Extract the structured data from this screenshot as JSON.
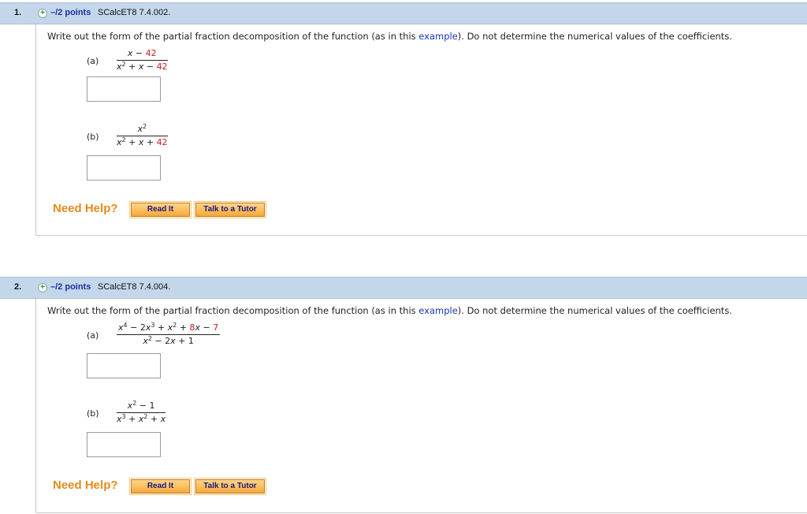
{
  "q1": {
    "number": "1.",
    "points": "–/2 points",
    "source": "SCalcET8 7.4.002.",
    "instruction_pre": "Write out the form of the partial fraction decomposition of the function (as in this ",
    "instruction_link": "example",
    "instruction_post": "). Do not determine the numerical values of the coefficients.",
    "a_label": "(a)",
    "b_label": "(b)",
    "help_label": "Need Help?",
    "read_label": "Read It",
    "tutor_label": "Talk to a Tutor"
  },
  "q2": {
    "number": "2.",
    "points": "–/2 points",
    "source": "SCalcET8 7.4.004.",
    "instruction_pre": "Write out the form of the partial fraction decomposition of the function (as in this ",
    "instruction_link": "example",
    "instruction_post": "). Do not determine the numerical values of the coefficients.",
    "a_label": "(a)",
    "b_label": "(b)",
    "help_label": "Need Help?",
    "read_label": "Read It",
    "tutor_label": "Talk to a Tutor"
  },
  "plus_symbol": "+",
  "colors": {
    "header_bg": "#c4d7ea",
    "link": "#1a35b5",
    "help": "#e58a1a",
    "red_number": "#c62020"
  }
}
